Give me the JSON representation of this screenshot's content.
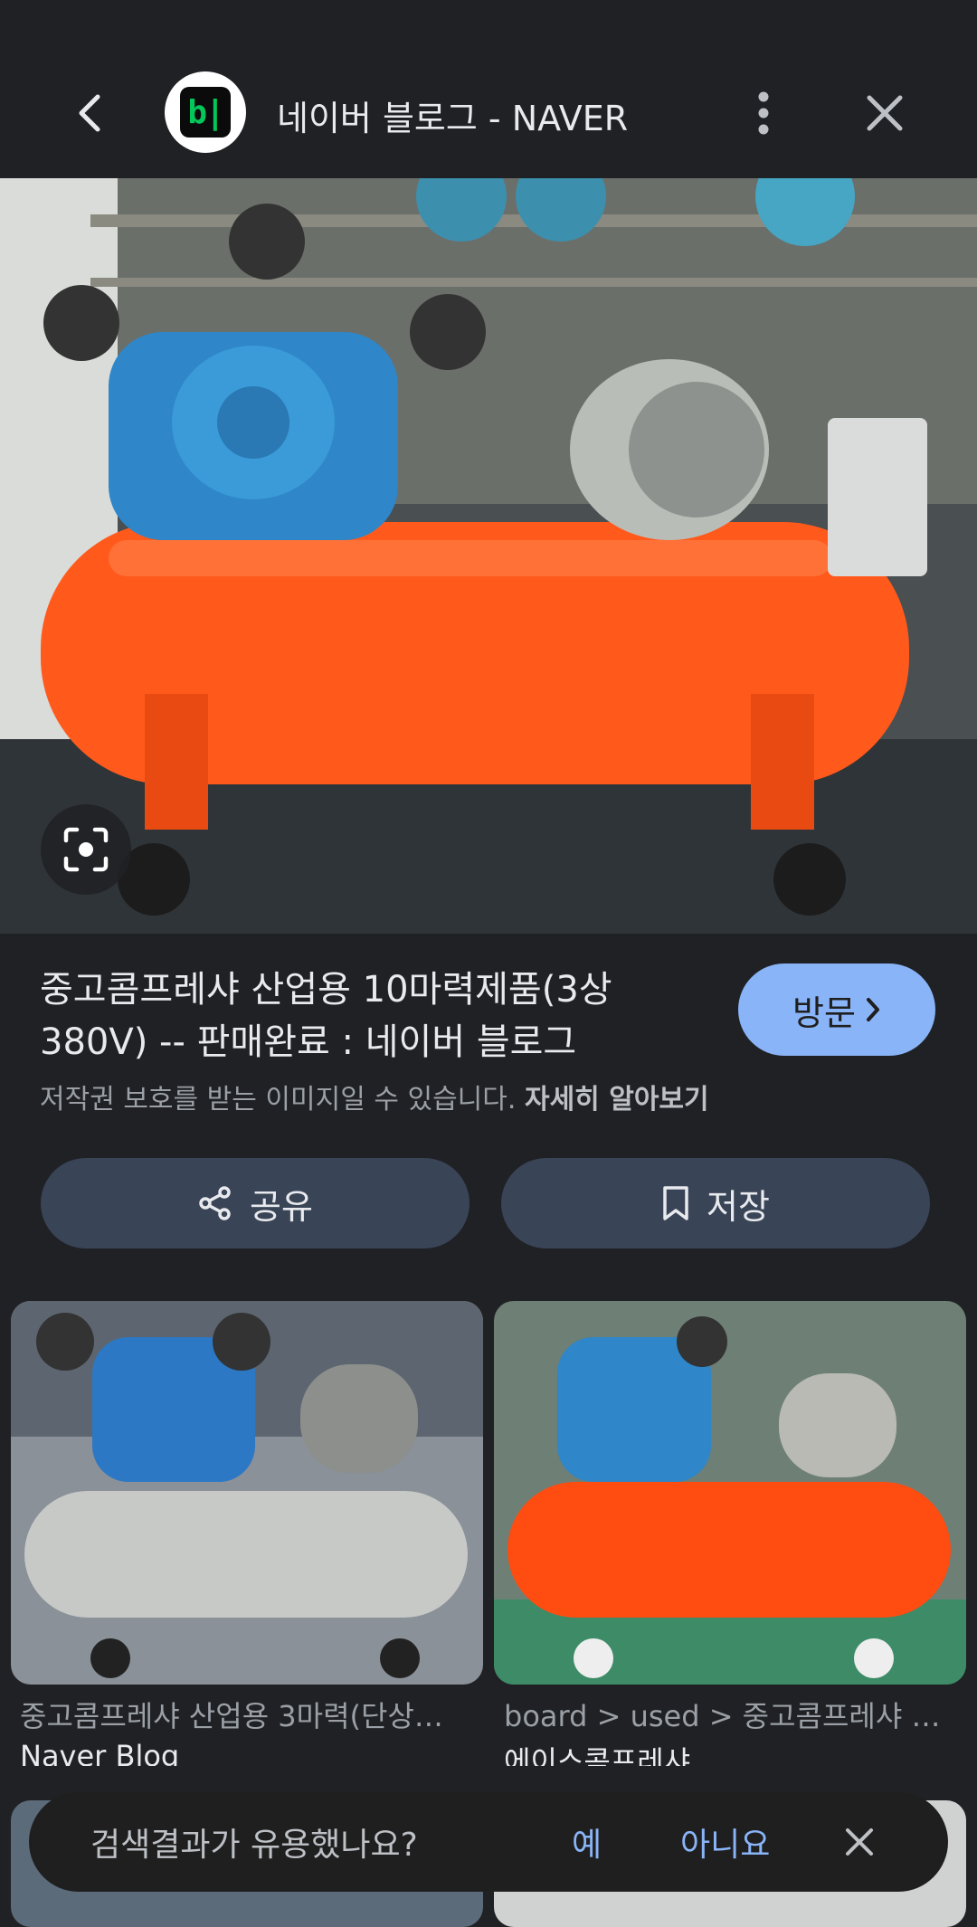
{
  "topbar": {
    "favicon_text": "b|",
    "site_title": "네이버 블로그 - NAVER"
  },
  "hero": {
    "description": "orange air compressor with blue pump"
  },
  "result": {
    "title": "중고콤프레샤 산업용 10마력제품(3상 380V) -- 판매완료 : 네이버 블로그",
    "visit_label": "방문",
    "copyright_text": "저작권 보호를 받는 이미지일 수 있습니다.",
    "learn_more": "자세히 알아보기"
  },
  "actions": {
    "share_label": "공유",
    "save_label": "저장"
  },
  "related": [
    {
      "title": "중고콤프레샤 산업용 3마력(단상…",
      "source": "Naver Blog"
    },
    {
      "title": "board > used > 중고콤프레샤 …",
      "source": "에이스콤프레샤"
    }
  ],
  "feedback": {
    "question": "검색결과가 유용했나요?",
    "yes": "예",
    "no": "아니요"
  },
  "colors": {
    "background": "#202124",
    "accent": "#8ab4f8",
    "action_button": "#394457"
  }
}
